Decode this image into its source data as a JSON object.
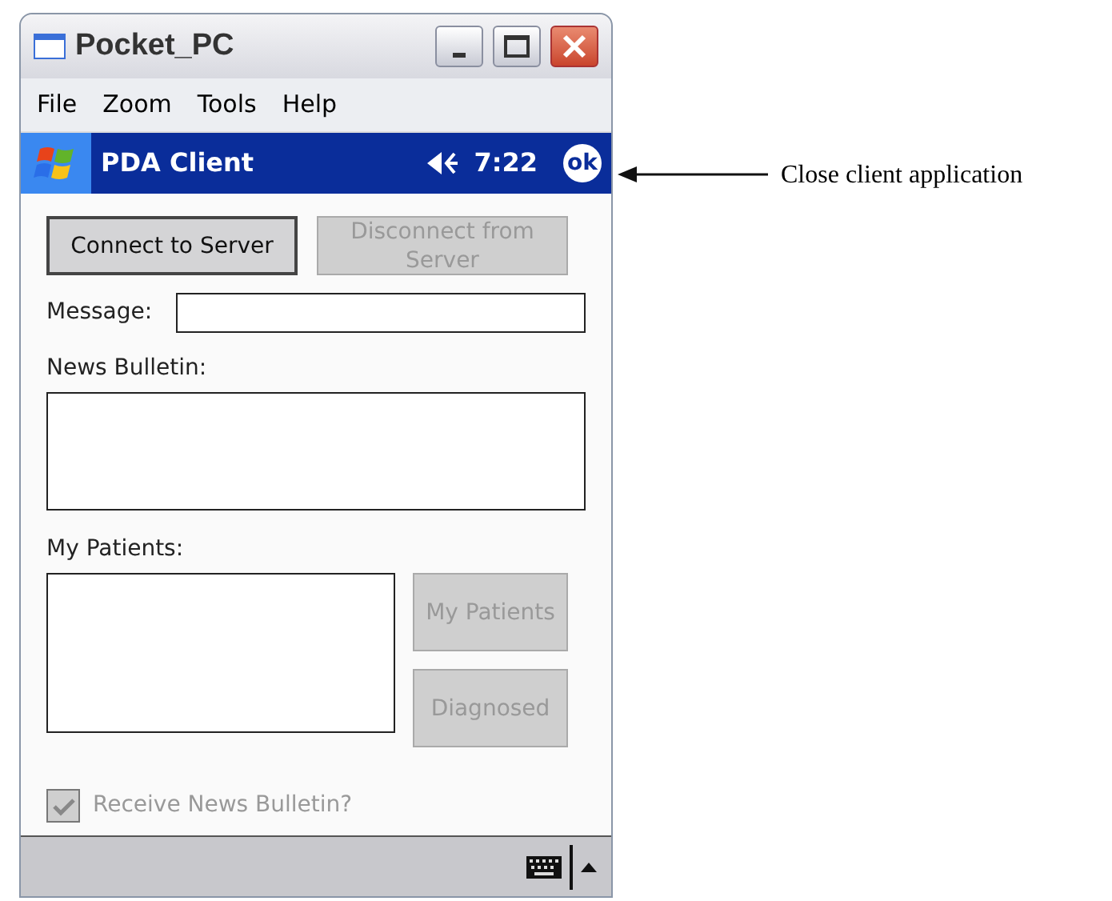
{
  "window": {
    "title": "Pocket_PC"
  },
  "menu": [
    "File",
    "Zoom",
    "Tools",
    "Help"
  ],
  "nav_bar": {
    "title": "PDA Client",
    "time": "7:22",
    "ok": "ok"
  },
  "connection_buttons": [
    {
      "label": "Connect to Server",
      "disabled": false
    },
    {
      "label": "Disconnect from Server",
      "disabled": true
    }
  ],
  "message": {
    "label": "Message:"
  },
  "news_bulletin": {
    "label": "News Bulletin:"
  },
  "my_patients": {
    "label": "My Patients:"
  },
  "patient_buttons": [
    {
      "label": "My Patients",
      "disabled": true
    },
    {
      "label": "Diagnosed",
      "disabled": true
    }
  ],
  "receive_checkbox": {
    "label": "Receive News Bulletin?",
    "checked": true,
    "disabled": true
  },
  "annotation": "Close client application"
}
